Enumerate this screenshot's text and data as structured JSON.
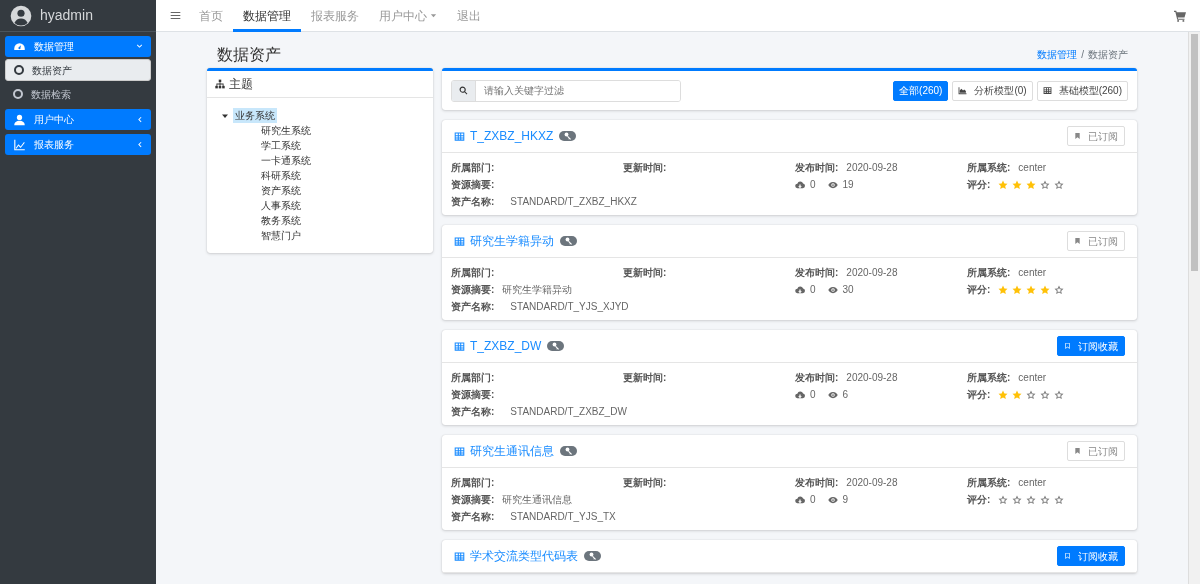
{
  "sidebar": {
    "user": "hyadmin",
    "items": [
      {
        "label": "数据管理",
        "expanded": true,
        "children": [
          {
            "label": "数据资产",
            "selected": true
          },
          {
            "label": "数据检索",
            "selected": false
          }
        ]
      },
      {
        "label": "用户中心",
        "expanded": false
      },
      {
        "label": "报表服务",
        "expanded": false
      }
    ]
  },
  "navbar": {
    "items": [
      {
        "label": "首页",
        "selected": false,
        "dropdown": false
      },
      {
        "label": "数据管理",
        "selected": true,
        "dropdown": false
      },
      {
        "label": "报表服务",
        "selected": false,
        "dropdown": false
      },
      {
        "label": "用户中心",
        "selected": false,
        "dropdown": true
      },
      {
        "label": "退出",
        "selected": false,
        "dropdown": false
      }
    ]
  },
  "page": {
    "title": "数据资产",
    "breadcrumb_separator": "/",
    "breadcrumb": [
      {
        "label": "数据管理",
        "selected": false
      },
      {
        "label": "数据资产",
        "selected": true
      }
    ]
  },
  "theme_panel": {
    "title": "主题",
    "tree": [
      {
        "label": "业务系统",
        "expanded": true,
        "selected": true,
        "children": [
          {
            "label": "研究生系统"
          },
          {
            "label": "学工系统"
          },
          {
            "label": "一卡通系统"
          },
          {
            "label": "科研系统"
          },
          {
            "label": "资产系统"
          },
          {
            "label": "人事系统"
          },
          {
            "label": "教务系统"
          },
          {
            "label": "智慧门户"
          }
        ]
      }
    ]
  },
  "filter": {
    "placeholder": "请输入关键字过滤",
    "buttons": [
      {
        "label": "全部(260)",
        "selected": true
      },
      {
        "label": "分析模型(0)",
        "selected": false
      },
      {
        "label": "基础模型(260)",
        "selected": false
      }
    ]
  },
  "assets": [
    {
      "title": "T_ZXBZ_HKXZ",
      "subscribed": true,
      "button": "已订阅",
      "details": {
        "department": {
          "label": "所属部门:"
        },
        "updated": {
          "label": "更新时间:"
        },
        "published": {
          "label": "发布时间:",
          "value": "2020-09-28"
        },
        "system": {
          "label": "所属系统:",
          "value": "center"
        },
        "summary": {
          "label": "资源摘要:"
        },
        "downloads": "0",
        "views": "19",
        "rating": {
          "label": "评分:",
          "stars": 3
        },
        "asset_name": {
          "label": "资产名称:",
          "value": "STANDARD/T_ZXBZ_HKXZ"
        }
      }
    },
    {
      "title": "研究生学籍异动",
      "subscribed": true,
      "button": "已订阅",
      "details": {
        "department": {
          "label": "所属部门:"
        },
        "updated": {
          "label": "更新时间:"
        },
        "published": {
          "label": "发布时间:",
          "value": "2020-09-28"
        },
        "system": {
          "label": "所属系统:",
          "value": "center"
        },
        "summary": {
          "label": "资源摘要:",
          "value": "研究生学籍异动"
        },
        "downloads": "0",
        "views": "30",
        "rating": {
          "label": "评分:",
          "stars": 4
        },
        "asset_name": {
          "label": "资产名称:",
          "value": "STANDARD/T_YJS_XJYD"
        }
      }
    },
    {
      "title": "T_ZXBZ_DW",
      "subscribed": false,
      "button": "订阅收藏",
      "details": {
        "department": {
          "label": "所属部门:"
        },
        "updated": {
          "label": "更新时间:"
        },
        "published": {
          "label": "发布时间:",
          "value": "2020-09-28"
        },
        "system": {
          "label": "所属系统:",
          "value": "center"
        },
        "summary": {
          "label": "资源摘要:"
        },
        "downloads": "0",
        "views": "6",
        "rating": {
          "label": "评分:",
          "stars": 2
        },
        "asset_name": {
          "label": "资产名称:",
          "value": "STANDARD/T_ZXBZ_DW"
        }
      }
    },
    {
      "title": "研究生通讯信息",
      "subscribed": true,
      "button": "已订阅",
      "details": {
        "department": {
          "label": "所属部门:"
        },
        "updated": {
          "label": "更新时间:"
        },
        "published": {
          "label": "发布时间:",
          "value": "2020-09-28"
        },
        "system": {
          "label": "所属系统:",
          "value": "center"
        },
        "summary": {
          "label": "资源摘要:",
          "value": "研究生通讯信息"
        },
        "downloads": "0",
        "views": "9",
        "rating": {
          "label": "评分:",
          "stars": 0
        },
        "asset_name": {
          "label": "资产名称:",
          "value": "STANDARD/T_YJS_TX"
        }
      }
    },
    {
      "title": "学术交流类型代码表",
      "subscribed": false,
      "button": "订阅收藏"
    }
  ]
}
